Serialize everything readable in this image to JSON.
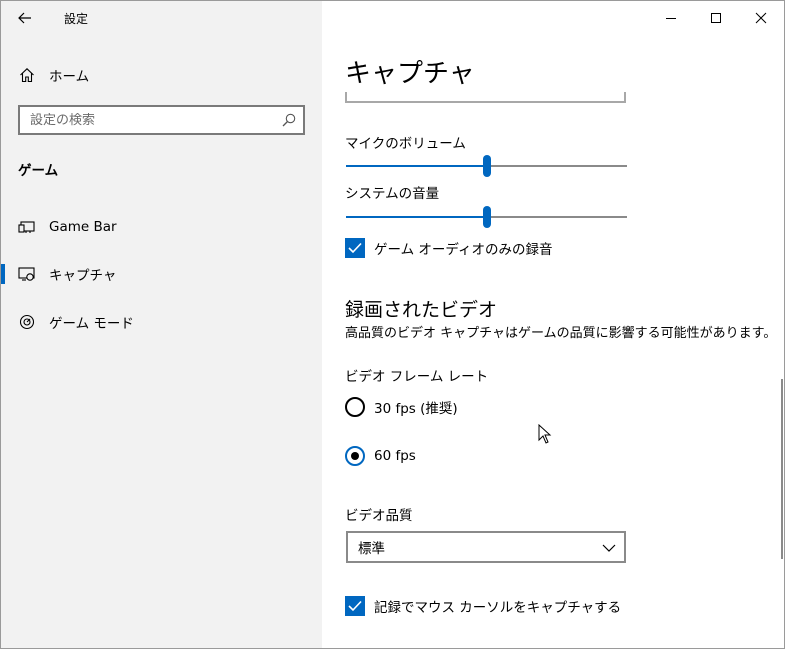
{
  "window": {
    "title": "設定",
    "controls": {
      "minimize": "minimize-icon",
      "maximize": "maximize-icon",
      "close": "close-icon"
    }
  },
  "sidebar": {
    "home_label": "ホーム",
    "search_placeholder": "設定の検索",
    "section_title": "ゲーム",
    "items": [
      {
        "label": "Game Bar",
        "icon": "game-bar-icon",
        "active": false
      },
      {
        "label": "キャプチャ",
        "icon": "capture-icon",
        "active": true
      },
      {
        "label": "ゲーム モード",
        "icon": "game-mode-icon",
        "active": false
      }
    ]
  },
  "main": {
    "page_title": "キャプチャ",
    "mic_volume": {
      "label": "マイクのボリューム",
      "value_percent": 50
    },
    "system_volume": {
      "label": "システムの音量",
      "value_percent": 50
    },
    "game_audio_only": {
      "label": "ゲーム オーディオのみの録音",
      "checked": true
    },
    "recorded_video": {
      "heading": "録画されたビデオ",
      "description": "高品質のビデオ キャプチャはゲームの品質に影響する可能性があります。"
    },
    "frame_rate": {
      "label": "ビデオ フレーム レート",
      "options": [
        {
          "label": "30 fps (推奨)",
          "checked": false
        },
        {
          "label": "60 fps",
          "checked": true
        }
      ]
    },
    "video_quality": {
      "label": "ビデオ品質",
      "selected": "標準"
    },
    "capture_cursor": {
      "label": "記録でマウス カーソルをキャプチャする",
      "checked": true
    }
  },
  "colors": {
    "accent": "#0067c0",
    "sidebar_bg": "#f2f2f2"
  }
}
